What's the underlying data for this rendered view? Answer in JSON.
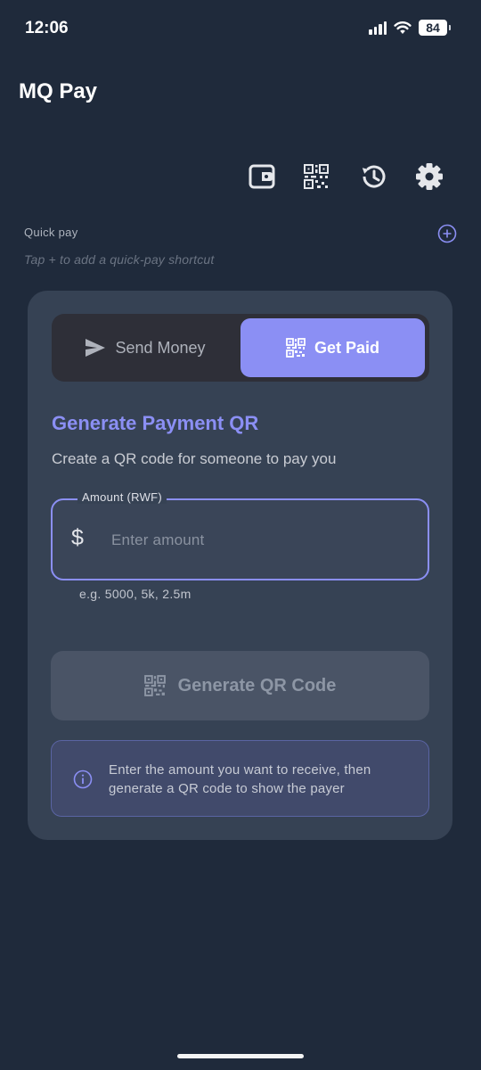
{
  "status_bar": {
    "time": "12:06",
    "battery": "84"
  },
  "app": {
    "title": "MQ Pay"
  },
  "toolbar": {
    "icons": [
      "wallet-icon",
      "qr-scan-icon",
      "history-icon",
      "gear-icon"
    ]
  },
  "quick_pay": {
    "label": "Quick pay",
    "hint": "Tap + to add a quick-pay shortcut"
  },
  "mode_toggle": {
    "send_label": "Send Money",
    "get_label": "Get Paid",
    "selected": "Get Paid"
  },
  "main": {
    "title": "Generate Payment QR",
    "subtitle": "Create a QR code for someone to pay you",
    "amount": {
      "label": "Amount (RWF)",
      "currency_symbol": "$",
      "value": "",
      "placeholder": "Enter amount",
      "helper": "e.g. 5000, 5k, 2.5m"
    },
    "generate_label": "Generate QR Code",
    "info": "Enter the amount you want to receive, then generate a QR code to show the payer"
  },
  "colors": {
    "background": "#1f2a3b",
    "card": "#364254",
    "accent": "#8b8ff4",
    "disabled_button": "#4a5466"
  }
}
